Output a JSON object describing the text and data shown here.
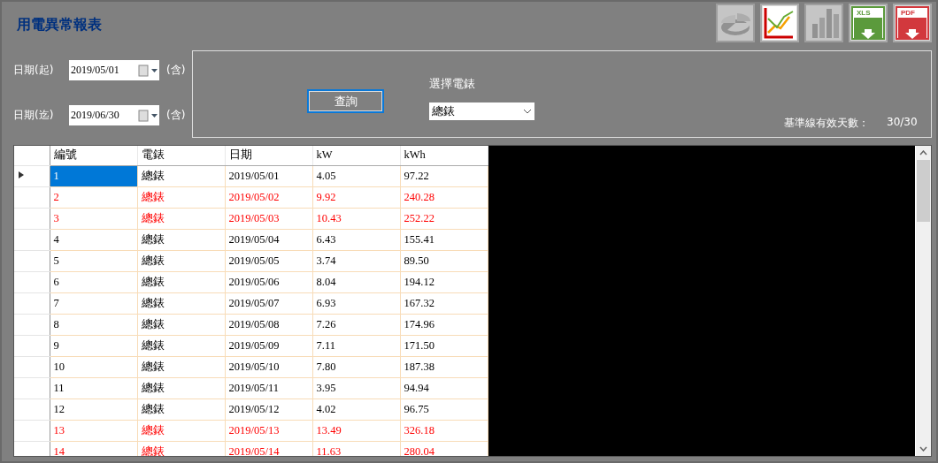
{
  "window": {
    "title": "用電異常報表"
  },
  "toolbar": [
    {
      "kind": "pie",
      "disabled": true
    },
    {
      "kind": "line",
      "disabled": false
    },
    {
      "kind": "bar",
      "disabled": true
    },
    {
      "kind": "xls",
      "label": "XLS",
      "disabled": false
    },
    {
      "kind": "pdf",
      "label": "PDF",
      "disabled": false
    }
  ],
  "filters": {
    "start": {
      "label": "日期(起)",
      "value": "2019/05/01",
      "suffix": "(含)"
    },
    "end": {
      "label": "日期(迄)",
      "value": "2019/06/30",
      "suffix": "(含)"
    }
  },
  "query_button": "查詢",
  "meter_select": {
    "label": "選擇電錶",
    "value": "總錶"
  },
  "baseline": {
    "label": "基準線有效天數：",
    "value": "30/30"
  },
  "table": {
    "columns": [
      "編號",
      "電錶",
      "日期",
      "kW",
      "kWh"
    ],
    "rows": [
      {
        "cells": [
          "1",
          "總錶",
          "2019/05/01",
          "4.05",
          "97.22"
        ],
        "alert": false,
        "selected": true
      },
      {
        "cells": [
          "2",
          "總錶",
          "2019/05/02",
          "9.92",
          "240.28"
        ],
        "alert": true,
        "selected": false
      },
      {
        "cells": [
          "3",
          "總錶",
          "2019/05/03",
          "10.43",
          "252.22"
        ],
        "alert": true,
        "selected": false
      },
      {
        "cells": [
          "4",
          "總錶",
          "2019/05/04",
          "6.43",
          "155.41"
        ],
        "alert": false,
        "selected": false
      },
      {
        "cells": [
          "5",
          "總錶",
          "2019/05/05",
          "3.74",
          "89.50"
        ],
        "alert": false,
        "selected": false
      },
      {
        "cells": [
          "6",
          "總錶",
          "2019/05/06",
          "8.04",
          "194.12"
        ],
        "alert": false,
        "selected": false
      },
      {
        "cells": [
          "7",
          "總錶",
          "2019/05/07",
          "6.93",
          "167.32"
        ],
        "alert": false,
        "selected": false
      },
      {
        "cells": [
          "8",
          "總錶",
          "2019/05/08",
          "7.26",
          "174.96"
        ],
        "alert": false,
        "selected": false
      },
      {
        "cells": [
          "9",
          "總錶",
          "2019/05/09",
          "7.11",
          "171.50"
        ],
        "alert": false,
        "selected": false
      },
      {
        "cells": [
          "10",
          "總錶",
          "2019/05/10",
          "7.80",
          "187.38"
        ],
        "alert": false,
        "selected": false
      },
      {
        "cells": [
          "11",
          "總錶",
          "2019/05/11",
          "3.95",
          "94.94"
        ],
        "alert": false,
        "selected": false
      },
      {
        "cells": [
          "12",
          "總錶",
          "2019/05/12",
          "4.02",
          "96.75"
        ],
        "alert": false,
        "selected": false
      },
      {
        "cells": [
          "13",
          "總錶",
          "2019/05/13",
          "13.49",
          "326.18"
        ],
        "alert": true,
        "selected": false
      },
      {
        "cells": [
          "14",
          "總錶",
          "2019/05/14",
          "11.63",
          "280.04"
        ],
        "alert": true,
        "selected": false
      }
    ]
  }
}
